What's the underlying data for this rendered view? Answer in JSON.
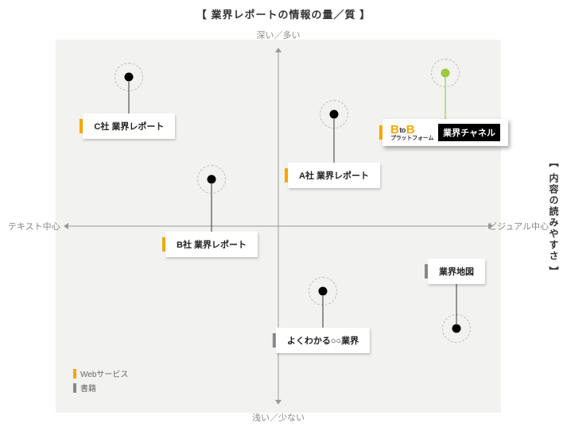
{
  "title": "【 業界レポートの情報の量／質 】",
  "side_title": "【 内容の読みやすさ 】",
  "axes": {
    "top": "深い／多い",
    "bottom": "浅い／少ない",
    "left": "テキスト中心",
    "right": "ビジュアル中心"
  },
  "legend": {
    "web": "Webサービス",
    "book": "書籍"
  },
  "points": {
    "c": {
      "label": "C社 業界レポート",
      "category": "web"
    },
    "b": {
      "label": "B社 業界レポート",
      "category": "web"
    },
    "a": {
      "label": "A社 業界レポート",
      "category": "web"
    },
    "btob": {
      "logo_sub": "プラットフォーム",
      "pill": "業界チャネル",
      "category": "web"
    },
    "easy": {
      "label": "よくわかる○○業界",
      "category": "book"
    },
    "map": {
      "label": "業界地図",
      "category": "book"
    }
  },
  "chart_data": {
    "type": "scatter",
    "title": "業界レポートの情報の量／質",
    "xlabel": "内容の読みやすさ",
    "ylabel": "業界レポートの情報の量／質",
    "x_axis_ends": {
      "negative": "テキスト中心",
      "positive": "ビジュアル中心"
    },
    "y_axis_ends": {
      "negative": "浅い／少ない",
      "positive": "深い／多い"
    },
    "xlim": [
      -1,
      1
    ],
    "ylim": [
      -1,
      1
    ],
    "legend": {
      "web": "Webサービス",
      "book": "書籍"
    },
    "series": [
      {
        "name": "C社 業界レポート",
        "category": "web",
        "x": -0.67,
        "y": 0.8
      },
      {
        "name": "B社 業界レポート",
        "category": "web",
        "x": -0.3,
        "y": 0.25
      },
      {
        "name": "A社 業界レポート",
        "category": "web",
        "x": 0.25,
        "y": 0.6
      },
      {
        "name": "BtoBプラットフォーム 業界チャネル",
        "category": "web",
        "x": 0.75,
        "y": 0.82,
        "highlighted": true
      },
      {
        "name": "よくわかる○○業界",
        "category": "book",
        "x": 0.2,
        "y": -0.35
      },
      {
        "name": "業界地図",
        "category": "book",
        "x": 0.8,
        "y": -0.55
      }
    ]
  }
}
